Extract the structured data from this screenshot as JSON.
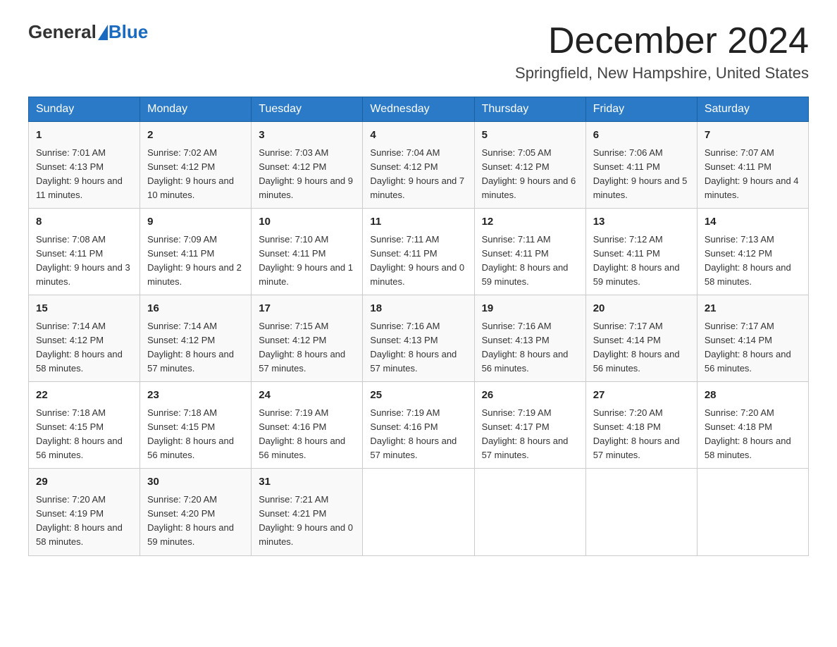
{
  "header": {
    "logo_general": "General",
    "logo_blue": "Blue",
    "month_title": "December 2024",
    "location": "Springfield, New Hampshire, United States"
  },
  "weekdays": [
    "Sunday",
    "Monday",
    "Tuesday",
    "Wednesday",
    "Thursday",
    "Friday",
    "Saturday"
  ],
  "weeks": [
    [
      {
        "day": "1",
        "sunrise": "7:01 AM",
        "sunset": "4:13 PM",
        "daylight": "9 hours and 11 minutes."
      },
      {
        "day": "2",
        "sunrise": "7:02 AM",
        "sunset": "4:12 PM",
        "daylight": "9 hours and 10 minutes."
      },
      {
        "day": "3",
        "sunrise": "7:03 AM",
        "sunset": "4:12 PM",
        "daylight": "9 hours and 9 minutes."
      },
      {
        "day": "4",
        "sunrise": "7:04 AM",
        "sunset": "4:12 PM",
        "daylight": "9 hours and 7 minutes."
      },
      {
        "day": "5",
        "sunrise": "7:05 AM",
        "sunset": "4:12 PM",
        "daylight": "9 hours and 6 minutes."
      },
      {
        "day": "6",
        "sunrise": "7:06 AM",
        "sunset": "4:11 PM",
        "daylight": "9 hours and 5 minutes."
      },
      {
        "day": "7",
        "sunrise": "7:07 AM",
        "sunset": "4:11 PM",
        "daylight": "9 hours and 4 minutes."
      }
    ],
    [
      {
        "day": "8",
        "sunrise": "7:08 AM",
        "sunset": "4:11 PM",
        "daylight": "9 hours and 3 minutes."
      },
      {
        "day": "9",
        "sunrise": "7:09 AM",
        "sunset": "4:11 PM",
        "daylight": "9 hours and 2 minutes."
      },
      {
        "day": "10",
        "sunrise": "7:10 AM",
        "sunset": "4:11 PM",
        "daylight": "9 hours and 1 minute."
      },
      {
        "day": "11",
        "sunrise": "7:11 AM",
        "sunset": "4:11 PM",
        "daylight": "9 hours and 0 minutes."
      },
      {
        "day": "12",
        "sunrise": "7:11 AM",
        "sunset": "4:11 PM",
        "daylight": "8 hours and 59 minutes."
      },
      {
        "day": "13",
        "sunrise": "7:12 AM",
        "sunset": "4:11 PM",
        "daylight": "8 hours and 59 minutes."
      },
      {
        "day": "14",
        "sunrise": "7:13 AM",
        "sunset": "4:12 PM",
        "daylight": "8 hours and 58 minutes."
      }
    ],
    [
      {
        "day": "15",
        "sunrise": "7:14 AM",
        "sunset": "4:12 PM",
        "daylight": "8 hours and 58 minutes."
      },
      {
        "day": "16",
        "sunrise": "7:14 AM",
        "sunset": "4:12 PM",
        "daylight": "8 hours and 57 minutes."
      },
      {
        "day": "17",
        "sunrise": "7:15 AM",
        "sunset": "4:12 PM",
        "daylight": "8 hours and 57 minutes."
      },
      {
        "day": "18",
        "sunrise": "7:16 AM",
        "sunset": "4:13 PM",
        "daylight": "8 hours and 57 minutes."
      },
      {
        "day": "19",
        "sunrise": "7:16 AM",
        "sunset": "4:13 PM",
        "daylight": "8 hours and 56 minutes."
      },
      {
        "day": "20",
        "sunrise": "7:17 AM",
        "sunset": "4:14 PM",
        "daylight": "8 hours and 56 minutes."
      },
      {
        "day": "21",
        "sunrise": "7:17 AM",
        "sunset": "4:14 PM",
        "daylight": "8 hours and 56 minutes."
      }
    ],
    [
      {
        "day": "22",
        "sunrise": "7:18 AM",
        "sunset": "4:15 PM",
        "daylight": "8 hours and 56 minutes."
      },
      {
        "day": "23",
        "sunrise": "7:18 AM",
        "sunset": "4:15 PM",
        "daylight": "8 hours and 56 minutes."
      },
      {
        "day": "24",
        "sunrise": "7:19 AM",
        "sunset": "4:16 PM",
        "daylight": "8 hours and 56 minutes."
      },
      {
        "day": "25",
        "sunrise": "7:19 AM",
        "sunset": "4:16 PM",
        "daylight": "8 hours and 57 minutes."
      },
      {
        "day": "26",
        "sunrise": "7:19 AM",
        "sunset": "4:17 PM",
        "daylight": "8 hours and 57 minutes."
      },
      {
        "day": "27",
        "sunrise": "7:20 AM",
        "sunset": "4:18 PM",
        "daylight": "8 hours and 57 minutes."
      },
      {
        "day": "28",
        "sunrise": "7:20 AM",
        "sunset": "4:18 PM",
        "daylight": "8 hours and 58 minutes."
      }
    ],
    [
      {
        "day": "29",
        "sunrise": "7:20 AM",
        "sunset": "4:19 PM",
        "daylight": "8 hours and 58 minutes."
      },
      {
        "day": "30",
        "sunrise": "7:20 AM",
        "sunset": "4:20 PM",
        "daylight": "8 hours and 59 minutes."
      },
      {
        "day": "31",
        "sunrise": "7:21 AM",
        "sunset": "4:21 PM",
        "daylight": "9 hours and 0 minutes."
      },
      null,
      null,
      null,
      null
    ]
  ]
}
